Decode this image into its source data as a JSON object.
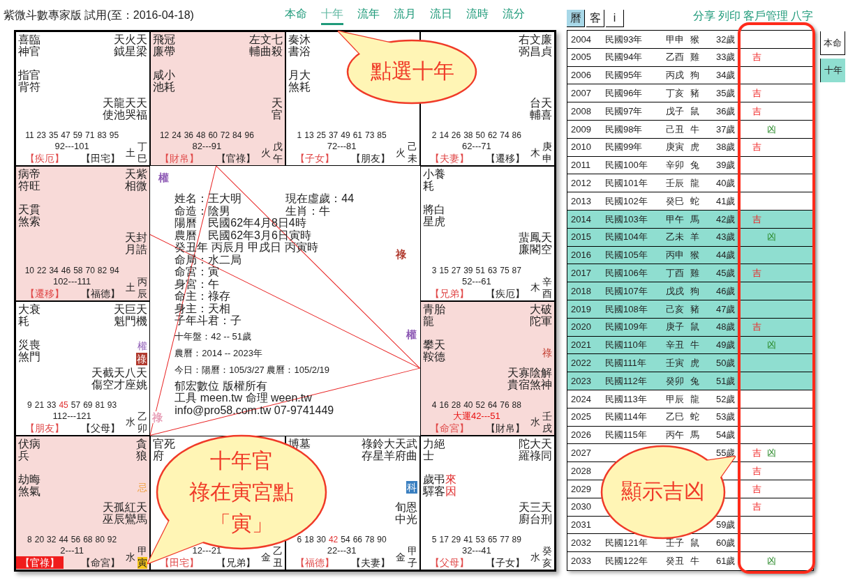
{
  "title": "紫微斗數專家版 試用(至：2016-04-18)",
  "tabs": [
    {
      "label": "本命",
      "selected": false
    },
    {
      "label": "十年",
      "selected": true
    },
    {
      "label": "流年",
      "selected": false
    },
    {
      "label": "流月",
      "selected": false
    },
    {
      "label": "流日",
      "selected": false
    },
    {
      "label": "流時",
      "selected": false
    },
    {
      "label": "流分",
      "selected": false
    }
  ],
  "palaces": [
    {
      "highlighted": false,
      "tl": [
        "喜臨",
        "神官"
      ],
      "tr": [
        "天火天",
        "鉞星梁"
      ],
      "ml": [
        "指官",
        "背符"
      ],
      "mr": [
        "天龍天天",
        "使池哭福"
      ],
      "ages": [
        {
          "text": "11",
          "hot": false
        },
        {
          "text": "23",
          "hot": false
        },
        {
          "text": "35",
          "hot": false
        },
        {
          "text": "47",
          "hot": false
        },
        {
          "text": "59",
          "hot": false
        },
        {
          "text": "71",
          "hot": false
        },
        {
          "text": "83",
          "hot": false
        },
        {
          "text": "95",
          "hot": false
        }
      ],
      "range": "92---101",
      "range_hot": false,
      "label1": "【疾厄】",
      "label1_active": false,
      "label2": "【田宅】",
      "element": "土",
      "stem": "丁",
      "branch": "巳",
      "branch_marked": false
    },
    {
      "highlighted": true,
      "tl": [
        "飛冠",
        "廉帶"
      ],
      "tr": [
        "左文七",
        "輔曲殺"
      ],
      "ml": [
        "咸小",
        "池耗"
      ],
      "mr": [
        "天",
        "官"
      ],
      "ages": [
        {
          "text": "12",
          "hot": false
        },
        {
          "text": "24",
          "hot": false
        },
        {
          "text": "36",
          "hot": false
        },
        {
          "text": "48",
          "hot": false
        },
        {
          "text": "60",
          "hot": false
        },
        {
          "text": "72",
          "hot": false
        },
        {
          "text": "84",
          "hot": false
        },
        {
          "text": "96",
          "hot": false
        }
      ],
      "range": "82---91",
      "range_hot": false,
      "label1": "【財帛】",
      "label1_active": false,
      "label2": "【官祿】",
      "element": "火",
      "stem": "戊",
      "branch": "午",
      "branch_marked": false
    },
    {
      "highlighted": false,
      "tl": [
        "奏沐",
        "書浴"
      ],
      "ml": [
        "月大",
        "煞耗"
      ],
      "ages": [
        {
          "text": "1",
          "hot": false
        },
        {
          "text": "13",
          "hot": false
        },
        {
          "text": "25",
          "hot": false
        },
        {
          "text": "37",
          "hot": false
        },
        {
          "text": "49",
          "hot": false
        },
        {
          "text": "61",
          "hot": false
        },
        {
          "text": "73",
          "hot": false
        },
        {
          "text": "85",
          "hot": false
        }
      ],
      "range": "72---81",
      "range_hot": false,
      "label1": "【子女】",
      "label1_active": false,
      "label2": "【朋友】",
      "element": "火",
      "stem": "己",
      "branch": "未",
      "branch_marked": false
    },
    {
      "highlighted": false,
      "tr": [
        "右文廉",
        "弼昌貞"
      ],
      "mr": [
        "台天",
        "輔喜"
      ],
      "ages": [
        {
          "text": "2",
          "hot": false
        },
        {
          "text": "14",
          "hot": false
        },
        {
          "text": "26",
          "hot": false
        },
        {
          "text": "38",
          "hot": false
        },
        {
          "text": "50",
          "hot": false
        },
        {
          "text": "62",
          "hot": false
        },
        {
          "text": "74",
          "hot": false
        },
        {
          "text": "86",
          "hot": false
        }
      ],
      "range": "62---71",
      "range_hot": false,
      "label1": "【夫妻】",
      "label1_active": false,
      "label2": "【遷移】",
      "element": "木",
      "stem": "庚",
      "branch": "申",
      "branch_marked": false
    },
    {
      "highlighted": true,
      "tl": [
        "病帝",
        "符旺"
      ],
      "tr": [
        "天紫",
        "相微"
      ],
      "ml": [
        "天貫",
        "煞索"
      ],
      "mr": [
        "天封",
        "月誥"
      ],
      "ages": [
        {
          "text": "10",
          "hot": false
        },
        {
          "text": "22",
          "hot": false
        },
        {
          "text": "34",
          "hot": false
        },
        {
          "text": "46",
          "hot": false
        },
        {
          "text": "58",
          "hot": false
        },
        {
          "text": "70",
          "hot": false
        },
        {
          "text": "82",
          "hot": false
        },
        {
          "text": "94",
          "hot": false
        }
      ],
      "range": "102---111",
      "range_hot": false,
      "label1": "【遷移】",
      "label1_active": false,
      "label2": "【福德】",
      "element": "土",
      "stem": "丙",
      "branch": "辰",
      "branch_marked": false
    },
    {
      "highlighted": false,
      "tl": [
        "小養",
        "耗"
      ],
      "ml": [
        "將白",
        "星虎"
      ],
      "mr": [
        "蜚鳳天",
        "廉閣空"
      ],
      "ages": [
        {
          "text": "3",
          "hot": false
        },
        {
          "text": "15",
          "hot": false
        },
        {
          "text": "27",
          "hot": false
        },
        {
          "text": "39",
          "hot": false
        },
        {
          "text": "51",
          "hot": false
        },
        {
          "text": "63",
          "hot": false
        },
        {
          "text": "75",
          "hot": false
        },
        {
          "text": "87",
          "hot": false
        }
      ],
      "range": "52---61",
      "range_hot": false,
      "label1": "【兄弟】",
      "label1_active": false,
      "label2": "【疾厄】",
      "element": "木",
      "stem": "辛",
      "branch": "酉",
      "branch_marked": false
    },
    {
      "highlighted": false,
      "tl": [
        "大衰",
        "耗"
      ],
      "tr": [
        "天巨天",
        "魁門機"
      ],
      "ml": [
        "災喪",
        "煞門"
      ],
      "mr": [
        "天截天八天",
        "傷空才座姚"
      ],
      "marks": [
        {
          "text": "權",
          "boxed": false,
          "color": "#8e5bb5"
        },
        {
          "text": "祿",
          "boxed": true,
          "color": "#b03a2e"
        }
      ],
      "ages": [
        {
          "text": "9",
          "hot": false
        },
        {
          "text": "21",
          "hot": false
        },
        {
          "text": "33",
          "hot": false
        },
        {
          "text": "45",
          "hot": true
        },
        {
          "text": "57",
          "hot": false
        },
        {
          "text": "69",
          "hot": false
        },
        {
          "text": "81",
          "hot": false
        },
        {
          "text": "93",
          "hot": false
        }
      ],
      "range": "112---121",
      "range_hot": false,
      "label1": "【朋友】",
      "label1_active": false,
      "label2": "【父母】",
      "element": "水",
      "stem": "乙",
      "branch": "卯",
      "branch_marked": false
    },
    {
      "highlighted": true,
      "tl": [
        "青胎",
        "龍"
      ],
      "tr": [
        "大破",
        "陀軍"
      ],
      "ml": [
        "攀天",
        "鞍德"
      ],
      "mr": [
        "天寡陰解",
        "貴宿煞神"
      ],
      "marks": [
        {
          "text": "祿",
          "boxed": false,
          "color": "#c0392b"
        }
      ],
      "ages": [
        {
          "text": "4",
          "hot": false
        },
        {
          "text": "16",
          "hot": false
        },
        {
          "text": "28",
          "hot": false
        },
        {
          "text": "40",
          "hot": false
        },
        {
          "text": "52",
          "hot": false
        },
        {
          "text": "64",
          "hot": false
        },
        {
          "text": "76",
          "hot": false
        },
        {
          "text": "88",
          "hot": false
        }
      ],
      "range": "大運42---51",
      "range_hot": true,
      "label1": "【命宮】",
      "label1_active": false,
      "label2": "【財帛】",
      "element": "水",
      "stem": "壬",
      "branch": "戌",
      "branch_marked": false
    },
    {
      "highlighted": true,
      "tl": [
        "伏病",
        "兵"
      ],
      "tr": [
        "貪",
        "狼"
      ],
      "ml": [
        "劫晦",
        "煞氣"
      ],
      "mr": [
        "天孤紅天",
        "巫辰鸞馬"
      ],
      "marks": [
        {
          "text": "忌",
          "boxed": false,
          "color": "#f0a040"
        }
      ],
      "ages": [
        {
          "text": "8",
          "hot": false
        },
        {
          "text": "20",
          "hot": false
        },
        {
          "text": "32",
          "hot": false
        },
        {
          "text": "44",
          "hot": false
        },
        {
          "text": "56",
          "hot": false
        },
        {
          "text": "68",
          "hot": false
        },
        {
          "text": "80",
          "hot": false
        },
        {
          "text": "92",
          "hot": false
        }
      ],
      "range": "2---11",
      "range_hot": false,
      "label1": "【官祿】",
      "label1_active": true,
      "label2": "【命宮】",
      "element": "水",
      "stem": "甲",
      "branch": "寅",
      "branch_marked": true
    },
    {
      "highlighted": false,
      "tl": [
        "官死",
        "府"
      ],
      "range": "12---21",
      "range_hot": false,
      "label1": "【田宅】",
      "label1_active": false,
      "label2": "【兄弟】",
      "element": "金",
      "stem": "乙",
      "branch": "丑",
      "branch_marked": false
    },
    {
      "highlighted": false,
      "tl": [
        "博墓"
      ],
      "tr": [
        "祿鈴大天武",
        "存星羊府曲"
      ],
      "mr": [
        "旬恩",
        "中光"
      ],
      "marks": [
        {
          "text": "科",
          "boxed": true,
          "color": "#3a7fc0"
        }
      ],
      "ages": [
        {
          "text": "6",
          "hot": false
        },
        {
          "text": "18",
          "hot": false
        },
        {
          "text": "30",
          "hot": false
        },
        {
          "text": "42",
          "hot": true
        },
        {
          "text": "54",
          "hot": false
        },
        {
          "text": "66",
          "hot": false
        },
        {
          "text": "78",
          "hot": false
        },
        {
          "text": "90",
          "hot": false
        }
      ],
      "range": "22---31",
      "range_hot": false,
      "label1": "【福德】",
      "label1_active": false,
      "label2": "【夫妻】",
      "element": "金",
      "stem": "甲",
      "branch": "子",
      "branch_marked": false
    },
    {
      "highlighted": false,
      "tl": [
        "力絕",
        "士"
      ],
      "tr": [
        "陀大天",
        "羅祿同"
      ],
      "ml": [
        "歲弔",
        "驛客"
      ],
      "ml_red": [
        "來",
        "因"
      ],
      "mr": [
        "天三天",
        "廚台刑"
      ],
      "ages": [
        {
          "text": "5",
          "hot": false
        },
        {
          "text": "17",
          "hot": false
        },
        {
          "text": "29",
          "hot": false
        },
        {
          "text": "41",
          "hot": false
        },
        {
          "text": "53",
          "hot": false
        },
        {
          "text": "65",
          "hot": false
        },
        {
          "text": "77",
          "hot": false
        },
        {
          "text": "89",
          "hot": false
        }
      ],
      "range": "32---41",
      "range_hot": false,
      "label1": "【父母】",
      "label1_active": false,
      "label2": "【子女】",
      "element": "水",
      "stem": "癸",
      "branch": "亥",
      "branch_marked": false
    }
  ],
  "center": {
    "pairs": [
      [
        "姓名：王大明",
        "現在虛歲：44"
      ],
      [
        "命造：陰男",
        "生肖：牛"
      ]
    ],
    "lines": [
      "陽曆　民國62年4月8日4時",
      "農曆　民國62年3月6日寅時",
      "癸丑年 丙辰月 甲戌日 丙寅時",
      "命局：水二局",
      "命宮：寅",
      "身宮：午",
      "命主：祿存",
      "身主：天相",
      "子年斗君：子"
    ],
    "small_lines": [
      "十年盤：42 -- 51歲",
      "農曆：2014 -- 2023年",
      "今日：陽曆：105/3/27 農曆：105/2/19"
    ],
    "footer": [
      "郁宏數位 版權所有",
      "工具 meen.tw 命理 ween.tw",
      "info@pro58.com.tw 07-9741449"
    ],
    "marks": [
      {
        "text": "權",
        "color": "#8e5bb5"
      },
      {
        "text": "祿",
        "color": "#b03a2e"
      },
      {
        "text": "權",
        "color": "#8e5bb5"
      },
      {
        "text": "祿",
        "color": "#e8a0b8"
      }
    ]
  },
  "toggles": [
    {
      "label": "曆",
      "selected": true
    },
    {
      "label": "客",
      "selected": false
    },
    {
      "label": "i",
      "selected": false
    }
  ],
  "links": [
    "分享",
    "列印",
    "客戶管理",
    "八字"
  ],
  "rows": [
    {
      "year": "2004",
      "roc": "民國93年",
      "gz": "甲申",
      "animal": "猴",
      "age": "32歲",
      "highlighted": false
    },
    {
      "year": "2005",
      "roc": "民國94年",
      "gz": "乙酉",
      "animal": "雞",
      "age": "33歲",
      "good": "吉",
      "highlighted": false
    },
    {
      "year": "2006",
      "roc": "民國95年",
      "gz": "丙戌",
      "animal": "狗",
      "age": "34歲",
      "highlighted": false
    },
    {
      "year": "2007",
      "roc": "民國96年",
      "gz": "丁亥",
      "animal": "豬",
      "age": "35歲",
      "good": "吉",
      "highlighted": false
    },
    {
      "year": "2008",
      "roc": "民國97年",
      "gz": "戊子",
      "animal": "鼠",
      "age": "36歲",
      "good": "吉",
      "highlighted": false
    },
    {
      "year": "2009",
      "roc": "民國98年",
      "gz": "己丑",
      "animal": "牛",
      "age": "37歲",
      "bad": "凶",
      "highlighted": false
    },
    {
      "year": "2010",
      "roc": "民國99年",
      "gz": "庚寅",
      "animal": "虎",
      "age": "38歲",
      "good": "吉",
      "highlighted": false
    },
    {
      "year": "2011",
      "roc": "民國100年",
      "gz": "辛卯",
      "animal": "兔",
      "age": "39歲",
      "highlighted": false
    },
    {
      "year": "2012",
      "roc": "民國101年",
      "gz": "壬辰",
      "animal": "龍",
      "age": "40歲",
      "highlighted": false
    },
    {
      "year": "2013",
      "roc": "民國102年",
      "gz": "癸巳",
      "animal": "蛇",
      "age": "41歲",
      "highlighted": false
    },
    {
      "year": "2014",
      "roc": "民國103年",
      "gz": "甲午",
      "animal": "馬",
      "age": "42歲",
      "good": "吉",
      "highlighted": true
    },
    {
      "year": "2015",
      "roc": "民國104年",
      "gz": "乙未",
      "animal": "羊",
      "age": "43歲",
      "bad": "凶",
      "highlighted": true
    },
    {
      "year": "2016",
      "roc": "民國105年",
      "gz": "丙申",
      "animal": "猴",
      "age": "44歲",
      "highlighted": true
    },
    {
      "year": "2017",
      "roc": "民國106年",
      "gz": "丁酉",
      "animal": "雞",
      "age": "45歲",
      "good": "吉",
      "highlighted": true
    },
    {
      "year": "2018",
      "roc": "民國107年",
      "gz": "戊戌",
      "animal": "狗",
      "age": "46歲",
      "highlighted": true
    },
    {
      "year": "2019",
      "roc": "民國108年",
      "gz": "己亥",
      "animal": "豬",
      "age": "47歲",
      "highlighted": true
    },
    {
      "year": "2020",
      "roc": "民國109年",
      "gz": "庚子",
      "animal": "鼠",
      "age": "48歲",
      "good": "吉",
      "highlighted": true
    },
    {
      "year": "2021",
      "roc": "民國110年",
      "gz": "辛丑",
      "animal": "牛",
      "age": "49歲",
      "bad": "凶",
      "highlighted": true
    },
    {
      "year": "2022",
      "roc": "民國111年",
      "gz": "壬寅",
      "animal": "虎",
      "age": "50歲",
      "highlighted": true
    },
    {
      "year": "2023",
      "roc": "民國112年",
      "gz": "癸卯",
      "animal": "兔",
      "age": "51歲",
      "highlighted": true
    },
    {
      "year": "2024",
      "roc": "民國113年",
      "gz": "甲辰",
      "animal": "龍",
      "age": "52歲",
      "highlighted": false
    },
    {
      "year": "2025",
      "roc": "民國114年",
      "gz": "乙巳",
      "animal": "蛇",
      "age": "53歲",
      "highlighted": false
    },
    {
      "year": "2026",
      "roc": "民國115年",
      "gz": "丙午",
      "animal": "馬",
      "age": "54歲",
      "highlighted": false
    },
    {
      "year": "2027",
      "age": "55歲",
      "good": "吉",
      "bad": "凶",
      "highlighted": false
    },
    {
      "year": "2028",
      "good": "吉",
      "highlighted": false
    },
    {
      "year": "2029",
      "good": "吉",
      "highlighted": false
    },
    {
      "year": "2030",
      "good": "吉",
      "highlighted": false
    },
    {
      "year": "2031",
      "age": "59歲",
      "highlighted": false
    },
    {
      "year": "2032",
      "roc": "民國121年",
      "gz": "壬子",
      "animal": "鼠",
      "age": "60歲",
      "highlighted": false
    },
    {
      "year": "2033",
      "roc": "民國122年",
      "gz": "癸丑",
      "animal": "牛",
      "age": "61歲",
      "bad": "凶",
      "highlighted": false
    }
  ],
  "side_tabs": [
    {
      "label": "本命",
      "selected": false
    },
    {
      "label": "十年",
      "selected": true
    }
  ],
  "callouts": [
    {
      "kind": "tab",
      "lines": [
        "點選十年"
      ]
    },
    {
      "kind": "palace",
      "lines": [
        "十年官",
        "祿在寅宮點",
        "「寅」"
      ]
    },
    {
      "kind": "table",
      "lines": [
        "顯示吉凶"
      ]
    }
  ]
}
